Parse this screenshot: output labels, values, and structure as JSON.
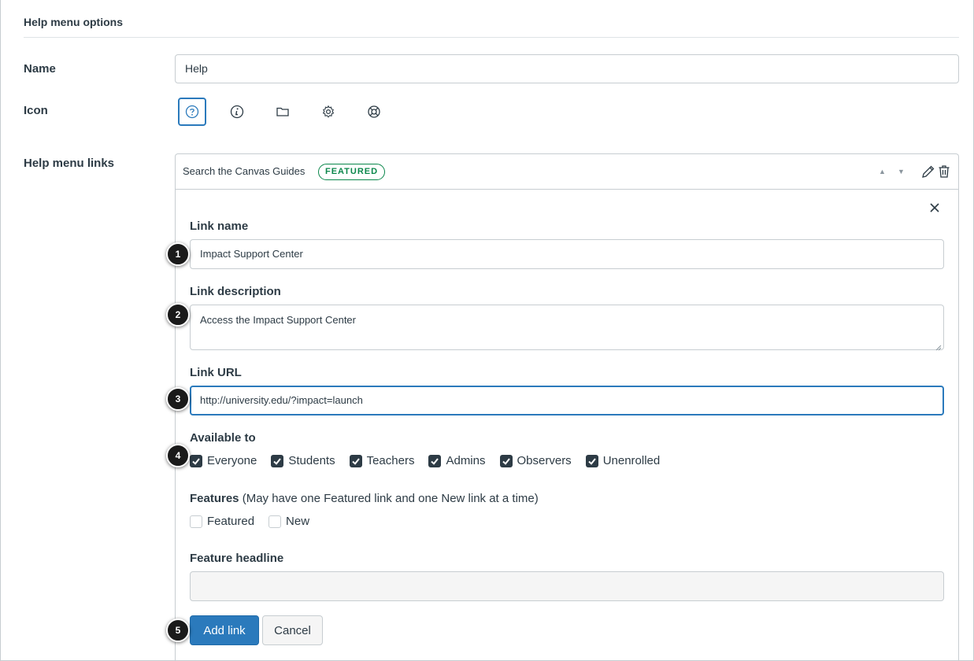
{
  "section": {
    "title": "Help menu options"
  },
  "name_row": {
    "label": "Name",
    "value": "Help"
  },
  "icon_row": {
    "label": "Icon",
    "icons": [
      "question-circle-icon",
      "info-icon",
      "folder-icon",
      "gear-icon",
      "lifesaver-icon"
    ],
    "selected": "question-circle-icon"
  },
  "links_row": {
    "label": "Help menu links",
    "header": {
      "title": "Search the Canvas Guides",
      "badge": "FEATURED"
    },
    "form": {
      "link_name_label": "Link name",
      "link_name_value": "Impact Support Center",
      "link_description_label": "Link description",
      "link_description_value": "Access the Impact Support Center",
      "link_url_label": "Link URL",
      "link_url_value": "http://university.edu/?impact=launch",
      "available_label": "Available to",
      "available": [
        {
          "label": "Everyone",
          "checked": true
        },
        {
          "label": "Students",
          "checked": true
        },
        {
          "label": "Teachers",
          "checked": true
        },
        {
          "label": "Admins",
          "checked": true
        },
        {
          "label": "Observers",
          "checked": true
        },
        {
          "label": "Unenrolled",
          "checked": true
        }
      ],
      "features_label": "Features",
      "features_note": "(May have one Featured link and one New link at a time)",
      "features": [
        {
          "label": "Featured",
          "checked": false
        },
        {
          "label": "New",
          "checked": false
        }
      ],
      "feature_headline_label": "Feature headline",
      "feature_headline_value": "",
      "add_button": "Add link",
      "cancel_button": "Cancel"
    }
  },
  "steps": [
    "1",
    "2",
    "3",
    "4",
    "5"
  ],
  "colors": {
    "text": "#2d3b45",
    "primary": "#2b7abc",
    "border": "#c7cdd1",
    "featured_green": "#0b874b",
    "checkbox_fill": "#2d3b45"
  }
}
